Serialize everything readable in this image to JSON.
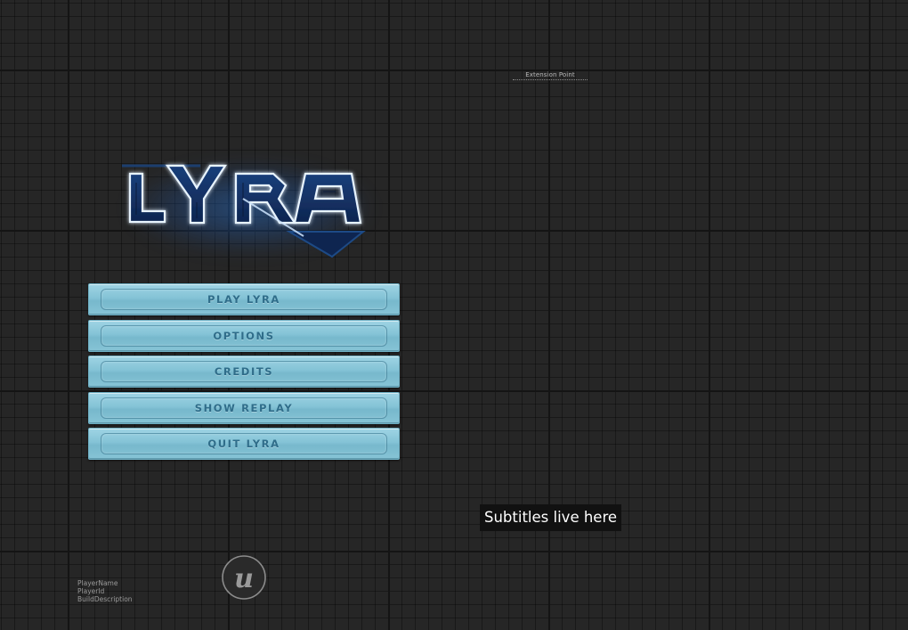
{
  "extension_point": {
    "label": "Extension Point"
  },
  "logo": {
    "text": "LYRA",
    "glow_color": "#2b7fd8",
    "stroke_color": "#e8f4ff"
  },
  "main_menu": {
    "items": [
      {
        "label": "PLAY LYRA"
      },
      {
        "label": "OPTIONS"
      },
      {
        "label": "CREDITS"
      },
      {
        "label": "SHOW REPLAY"
      },
      {
        "label": "QUIT LYRA"
      }
    ],
    "button_color": "#8ecbde",
    "label_color": "#2f6d8a"
  },
  "subtitles": {
    "text": "Subtitles live here"
  },
  "engine_logo": {
    "icon": "unreal-engine-logo-icon",
    "glyph": "u"
  },
  "player_info": {
    "player_name": "PlayerName",
    "player_id": "PlayerId",
    "build_description": "BuildDescription"
  }
}
